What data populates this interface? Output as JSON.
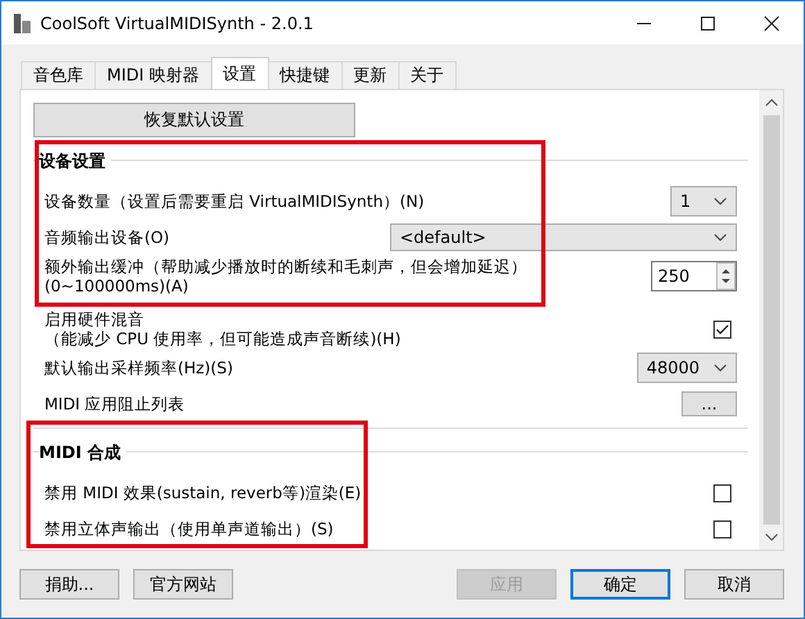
{
  "window": {
    "title": "CoolSoft VirtualMIDISynth - 2.0.1"
  },
  "tabs": [
    {
      "label": "音色库",
      "selected": false
    },
    {
      "label": "MIDI 映射器",
      "selected": false
    },
    {
      "label": "设置",
      "selected": true
    },
    {
      "label": "快捷键",
      "selected": false
    },
    {
      "label": "更新",
      "selected": false
    },
    {
      "label": "关于",
      "selected": false
    }
  ],
  "reset_button": "恢复默认设置",
  "groups": [
    {
      "title": "设备设置",
      "rows": [
        {
          "kind": "select",
          "label": "设备数量（设置后需要重启 VirtualMIDISynth）(N)",
          "value": "1"
        },
        {
          "kind": "wide-select",
          "label": "音频输出设备(O)",
          "value": "<default>"
        },
        {
          "kind": "spin",
          "label": "额外输出缓冲（帮助减少播放时的断续和毛刺声，但会增加延迟）",
          "sublabel": "(0~100000ms)(A)",
          "value": "250"
        },
        {
          "kind": "checkbox",
          "label": "启用硬件混音",
          "sublabel": "（能减少 CPU 使用率，但可能造成声音断续)(H)",
          "checked": true
        },
        {
          "kind": "select",
          "label": "默认输出采样频率(Hz)(S)",
          "value": "48000"
        },
        {
          "kind": "button",
          "label": "MIDI 应用阻止列表",
          "value": "..."
        }
      ]
    },
    {
      "title": "MIDI 合成",
      "rows": [
        {
          "kind": "checkbox",
          "label": "禁用 MIDI 效果(sustain, reverb等)渲染(E)",
          "checked": false
        },
        {
          "kind": "checkbox",
          "label": "禁用立体声输出（使用单声道输出）(S)",
          "checked": false
        }
      ]
    }
  ],
  "footer_left": [
    "捐助...",
    "官方网站"
  ],
  "footer_right": [
    {
      "label": "应用",
      "disabled": true,
      "default": false
    },
    {
      "label": "确定",
      "disabled": false,
      "default": true
    },
    {
      "label": "取消",
      "disabled": false,
      "default": false
    }
  ]
}
